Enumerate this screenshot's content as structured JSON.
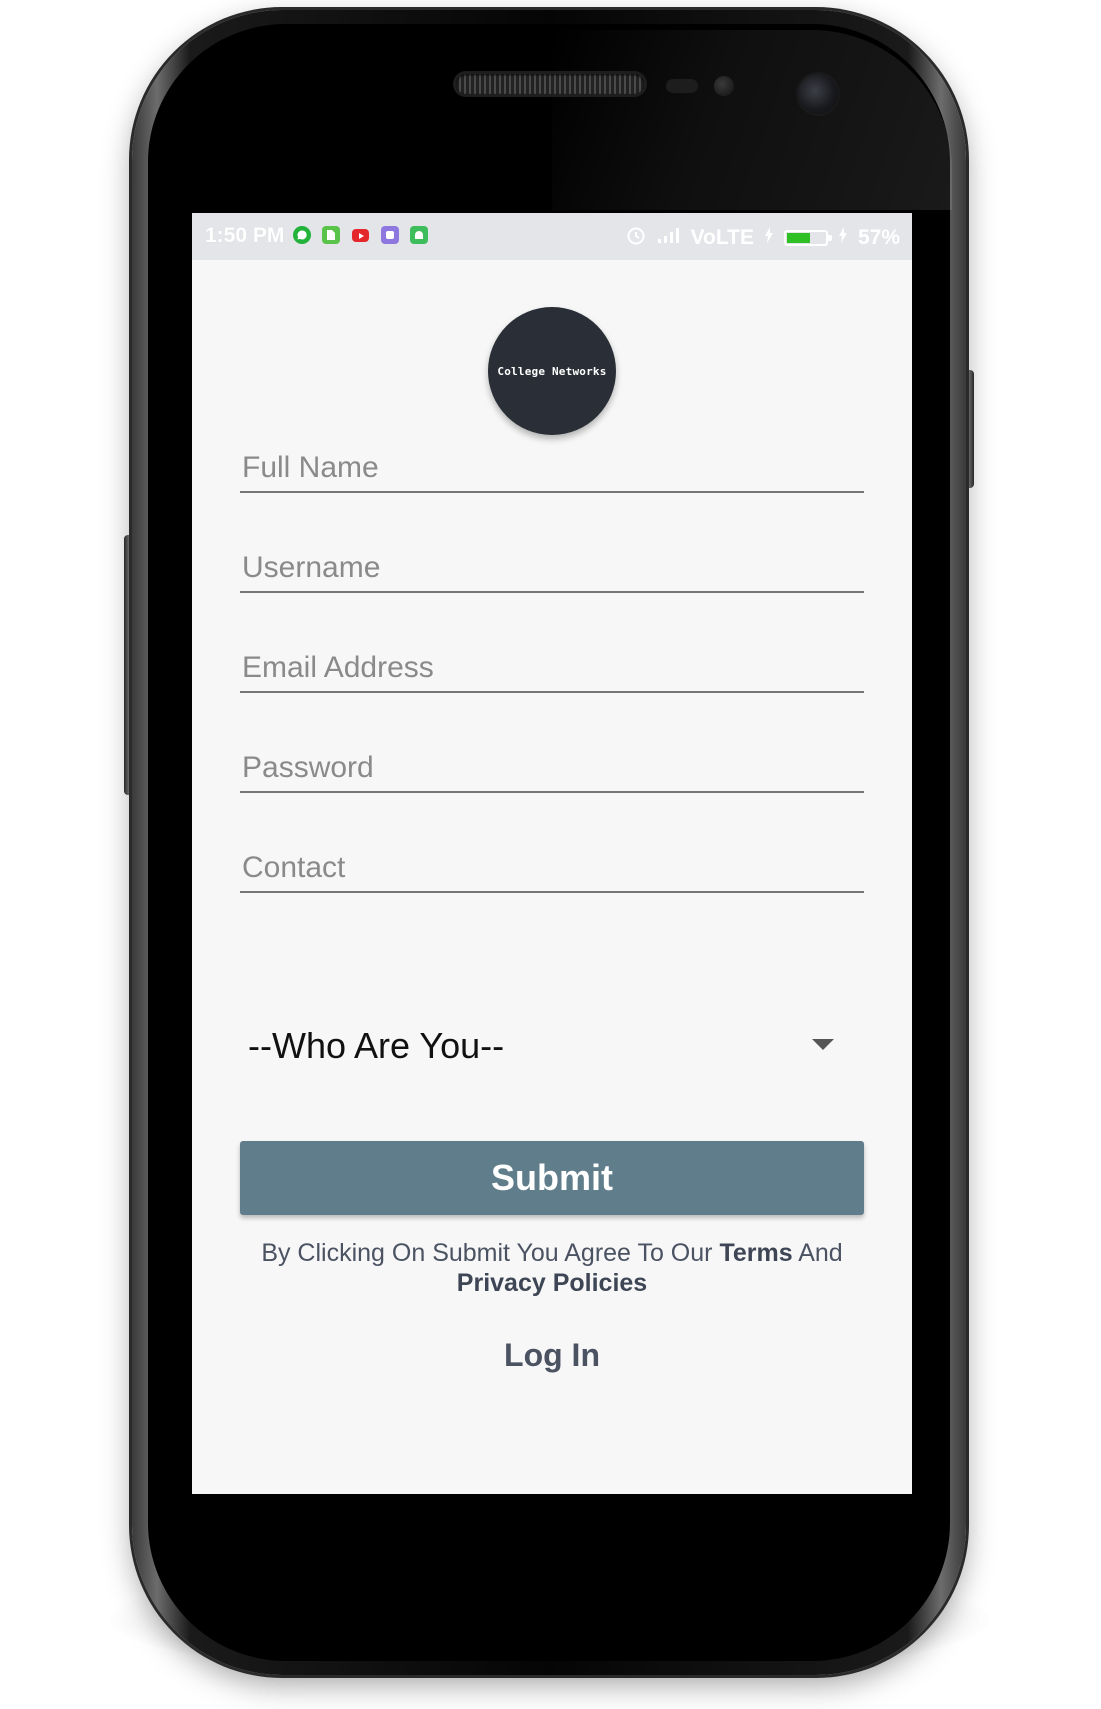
{
  "status_bar": {
    "time": "1:50 PM",
    "notification_icons": [
      "whatsapp-icon",
      "sim-icon",
      "youtube-icon",
      "app-icon",
      "android-icon"
    ],
    "network": "VoLTE",
    "battery_percent": "57%",
    "battery_level": 0.57
  },
  "logo": {
    "text": "College Networks"
  },
  "form": {
    "full_name": {
      "placeholder": "Full Name",
      "value": ""
    },
    "username": {
      "placeholder": "Username",
      "value": ""
    },
    "email": {
      "placeholder": "Email Address",
      "value": ""
    },
    "password": {
      "placeholder": "Password",
      "value": ""
    },
    "contact": {
      "placeholder": "Contact",
      "value": ""
    },
    "role_select": {
      "selected": "--Who Are You--"
    },
    "submit_label": "Submit"
  },
  "terms": {
    "prefix": "By Clicking On Submit You Agree To Our ",
    "terms_link": "Terms",
    "middle": " And",
    "privacy_link": "Privacy Policies"
  },
  "login_label": "Log In",
  "colors": {
    "button": "#607d8b",
    "screen_bg": "#f7f7f7",
    "status_bar_bg": "#e3e5e8",
    "link_text": "#4b5363",
    "battery_fill": "#2ec025"
  }
}
